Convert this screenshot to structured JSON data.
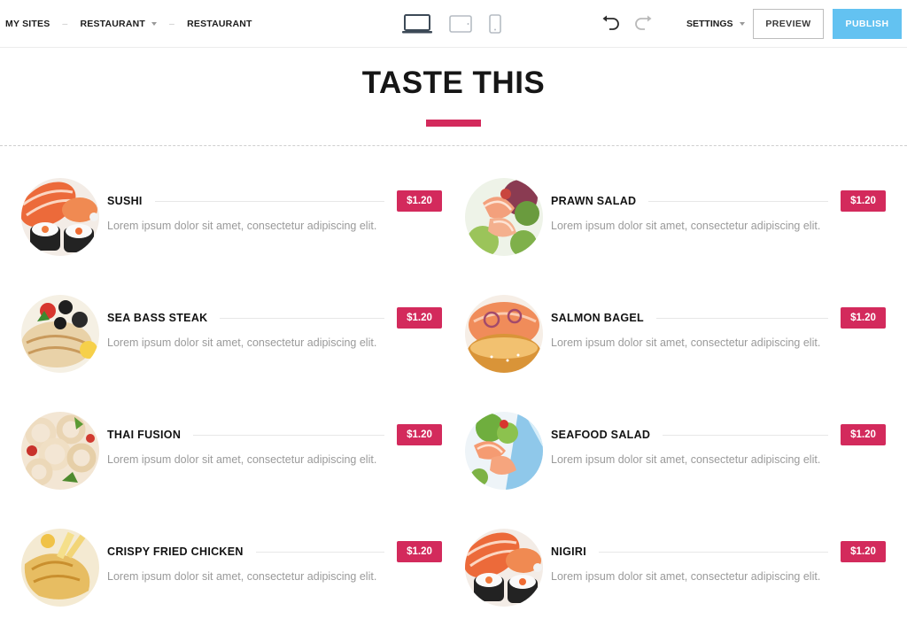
{
  "toolbar": {
    "breadcrumbs": [
      "MY SITES",
      "RESTAURANT",
      "RESTAURANT"
    ],
    "breadcrumb_separator": "–",
    "devices": [
      "desktop-icon",
      "tablet-icon",
      "mobile-icon"
    ],
    "settings_label": "SETTINGS",
    "preview_label": "PREVIEW",
    "publish_label": "PUBLISH"
  },
  "page": {
    "title": "TASTE THIS"
  },
  "menu": {
    "items": [
      {
        "name": "SUSHI",
        "price": "$1.20",
        "description": "Lorem ipsum dolor sit amet, consectetur adipiscing elit.",
        "photo": "sushi-photo"
      },
      {
        "name": "PRAWN SALAD",
        "price": "$1.20",
        "description": "Lorem ipsum dolor sit amet, consectetur adipiscing elit.",
        "photo": "prawn-salad-photo"
      },
      {
        "name": "SEA BASS STEAK",
        "price": "$1.20",
        "description": "Lorem ipsum dolor sit amet, consectetur adipiscing elit.",
        "photo": "sea-bass-steak-photo"
      },
      {
        "name": "SALMON BAGEL",
        "price": "$1.20",
        "description": "Lorem ipsum dolor sit amet, consectetur adipiscing elit.",
        "photo": "salmon-bagel-photo"
      },
      {
        "name": "THAI FUSION",
        "price": "$1.20",
        "description": "Lorem ipsum dolor sit amet, consectetur adipiscing elit.",
        "photo": "thai-fusion-photo"
      },
      {
        "name": "SEAFOOD SALAD",
        "price": "$1.20",
        "description": "Lorem ipsum dolor sit amet, consectetur adipiscing elit.",
        "photo": "seafood-salad-photo"
      },
      {
        "name": "CRISPY FRIED CHICKEN",
        "price": "$1.20",
        "description": "Lorem ipsum dolor sit amet, consectetur adipiscing elit.",
        "photo": "crispy-fried-chicken-photo"
      },
      {
        "name": "NIGIRI",
        "price": "$1.20",
        "description": "Lorem ipsum dolor sit amet, consectetur adipiscing elit.",
        "photo": "nigiri-photo"
      }
    ]
  },
  "colors": {
    "accent": "#d32a5c",
    "publish": "#63c2f1",
    "text_dark": "#161616",
    "text_muted": "#9a9a9a"
  }
}
